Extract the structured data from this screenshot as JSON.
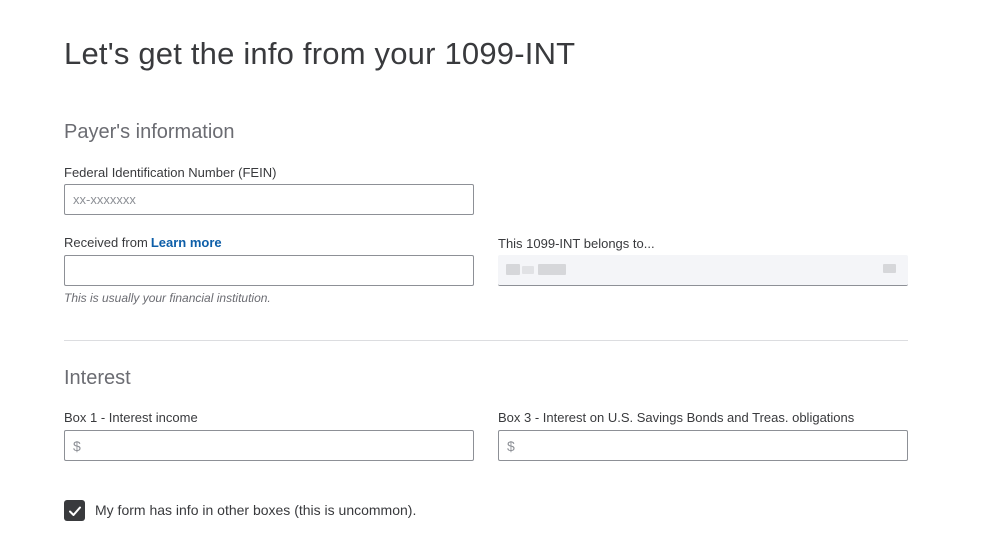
{
  "page_title": "Let's get the info from your 1099-INT",
  "payer_section": {
    "title": "Payer's information",
    "fein": {
      "label": "Federal Identification Number (FEIN)",
      "placeholder": "xx-xxxxxxx",
      "value": ""
    },
    "received_from": {
      "label": "Received from",
      "link_text": "Learn more",
      "value": "",
      "helper": "This is usually your financial institution."
    },
    "belongs_to": {
      "label": "This 1099-INT belongs to..."
    }
  },
  "interest_section": {
    "title": "Interest",
    "box1": {
      "label": "Box 1 - Interest income",
      "currency": "$",
      "value": ""
    },
    "box3": {
      "label": "Box 3 - Interest on U.S. Savings Bonds and Treas. obligations",
      "currency": "$",
      "value": ""
    }
  },
  "other_boxes": {
    "label": "My form has info in other boxes (this is uncommon).",
    "checked": true
  },
  "icons": {
    "checkbox": "checkmark-icon"
  },
  "colors": {
    "link": "#0d5ea8",
    "text": "#393a3d",
    "muted": "#6b6c72",
    "checkbox_fill": "#393a3d"
  }
}
